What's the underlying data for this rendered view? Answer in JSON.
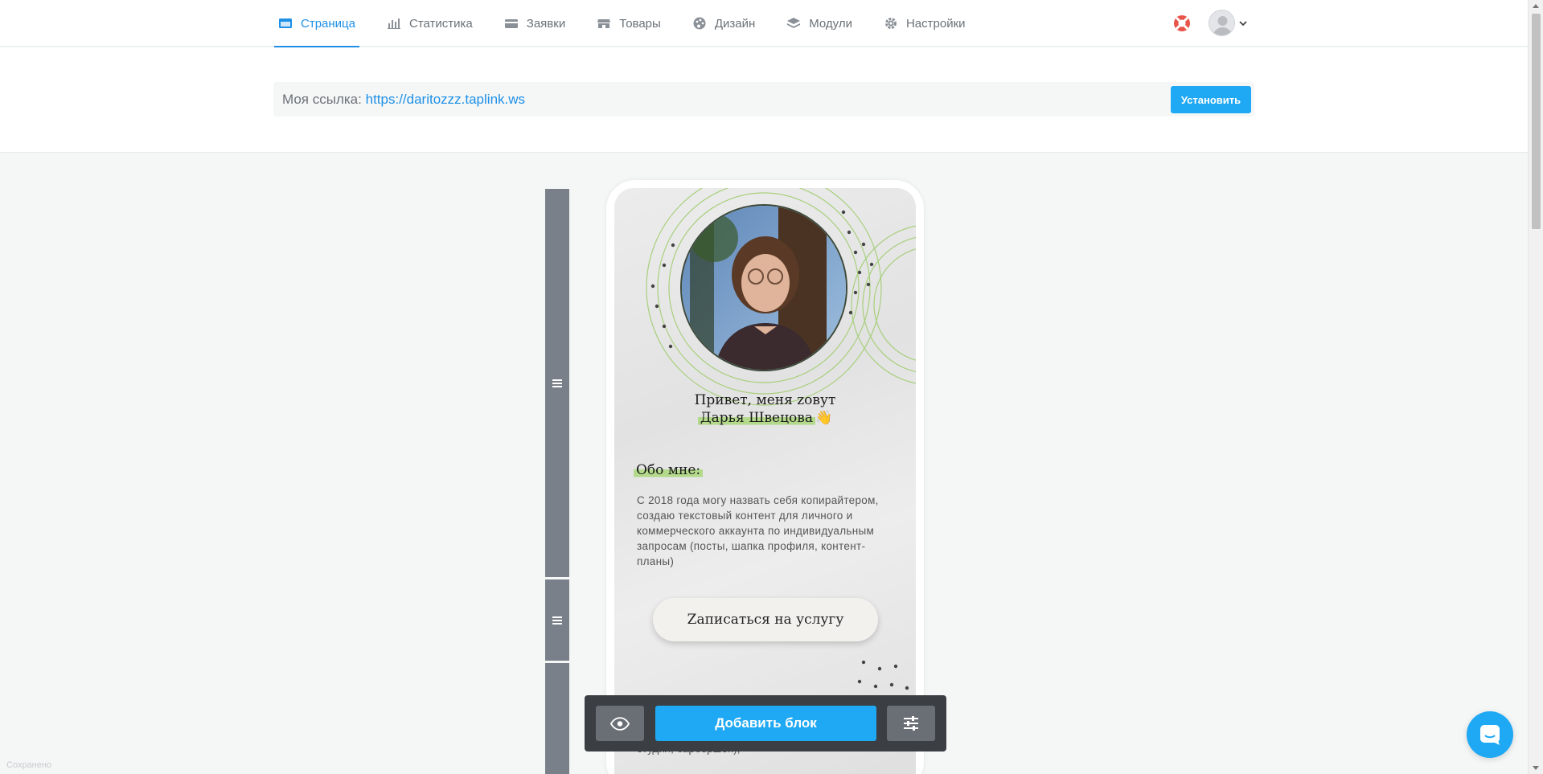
{
  "nav": {
    "items": [
      {
        "label": "Страница",
        "icon": "page-icon",
        "active": true
      },
      {
        "label": "Статистика",
        "icon": "stats-icon"
      },
      {
        "label": "Заявки",
        "icon": "card-icon"
      },
      {
        "label": "Товары",
        "icon": "store-icon"
      },
      {
        "label": "Дизайн",
        "icon": "palette-icon"
      },
      {
        "label": "Модули",
        "icon": "layers-icon"
      },
      {
        "label": "Настройки",
        "icon": "gear-icon"
      }
    ]
  },
  "link": {
    "label": "Моя ссылка:",
    "url": "https://daritozzz.taplink.ws",
    "install_label": "Установить"
  },
  "profile": {
    "greeting_line1": "Привет, меня zовут",
    "greeting_name": "Дарья Швецова",
    "greeting_emoji": "👋",
    "about_title": "Обо мне:",
    "about_text": "С 2018 года могу назвать себя копирайтером, создаю текстовый контент для личного и коммерческого аккаунта по индивидуальным запросам (посты, шапка профиля, контент-планы)",
    "service_button": "Zаписаться на услугу",
    "bottom_text": "студия, барбершоп),"
  },
  "toolbar": {
    "add_block_label": "Добавить блок"
  },
  "status_text": "Сохранено",
  "colors": {
    "accent": "#1e90e6",
    "button_blue": "#1fa8f3",
    "handle": "#7a8089",
    "toolbar": "#3b3e42",
    "highlight_green": "#b3d98a"
  }
}
